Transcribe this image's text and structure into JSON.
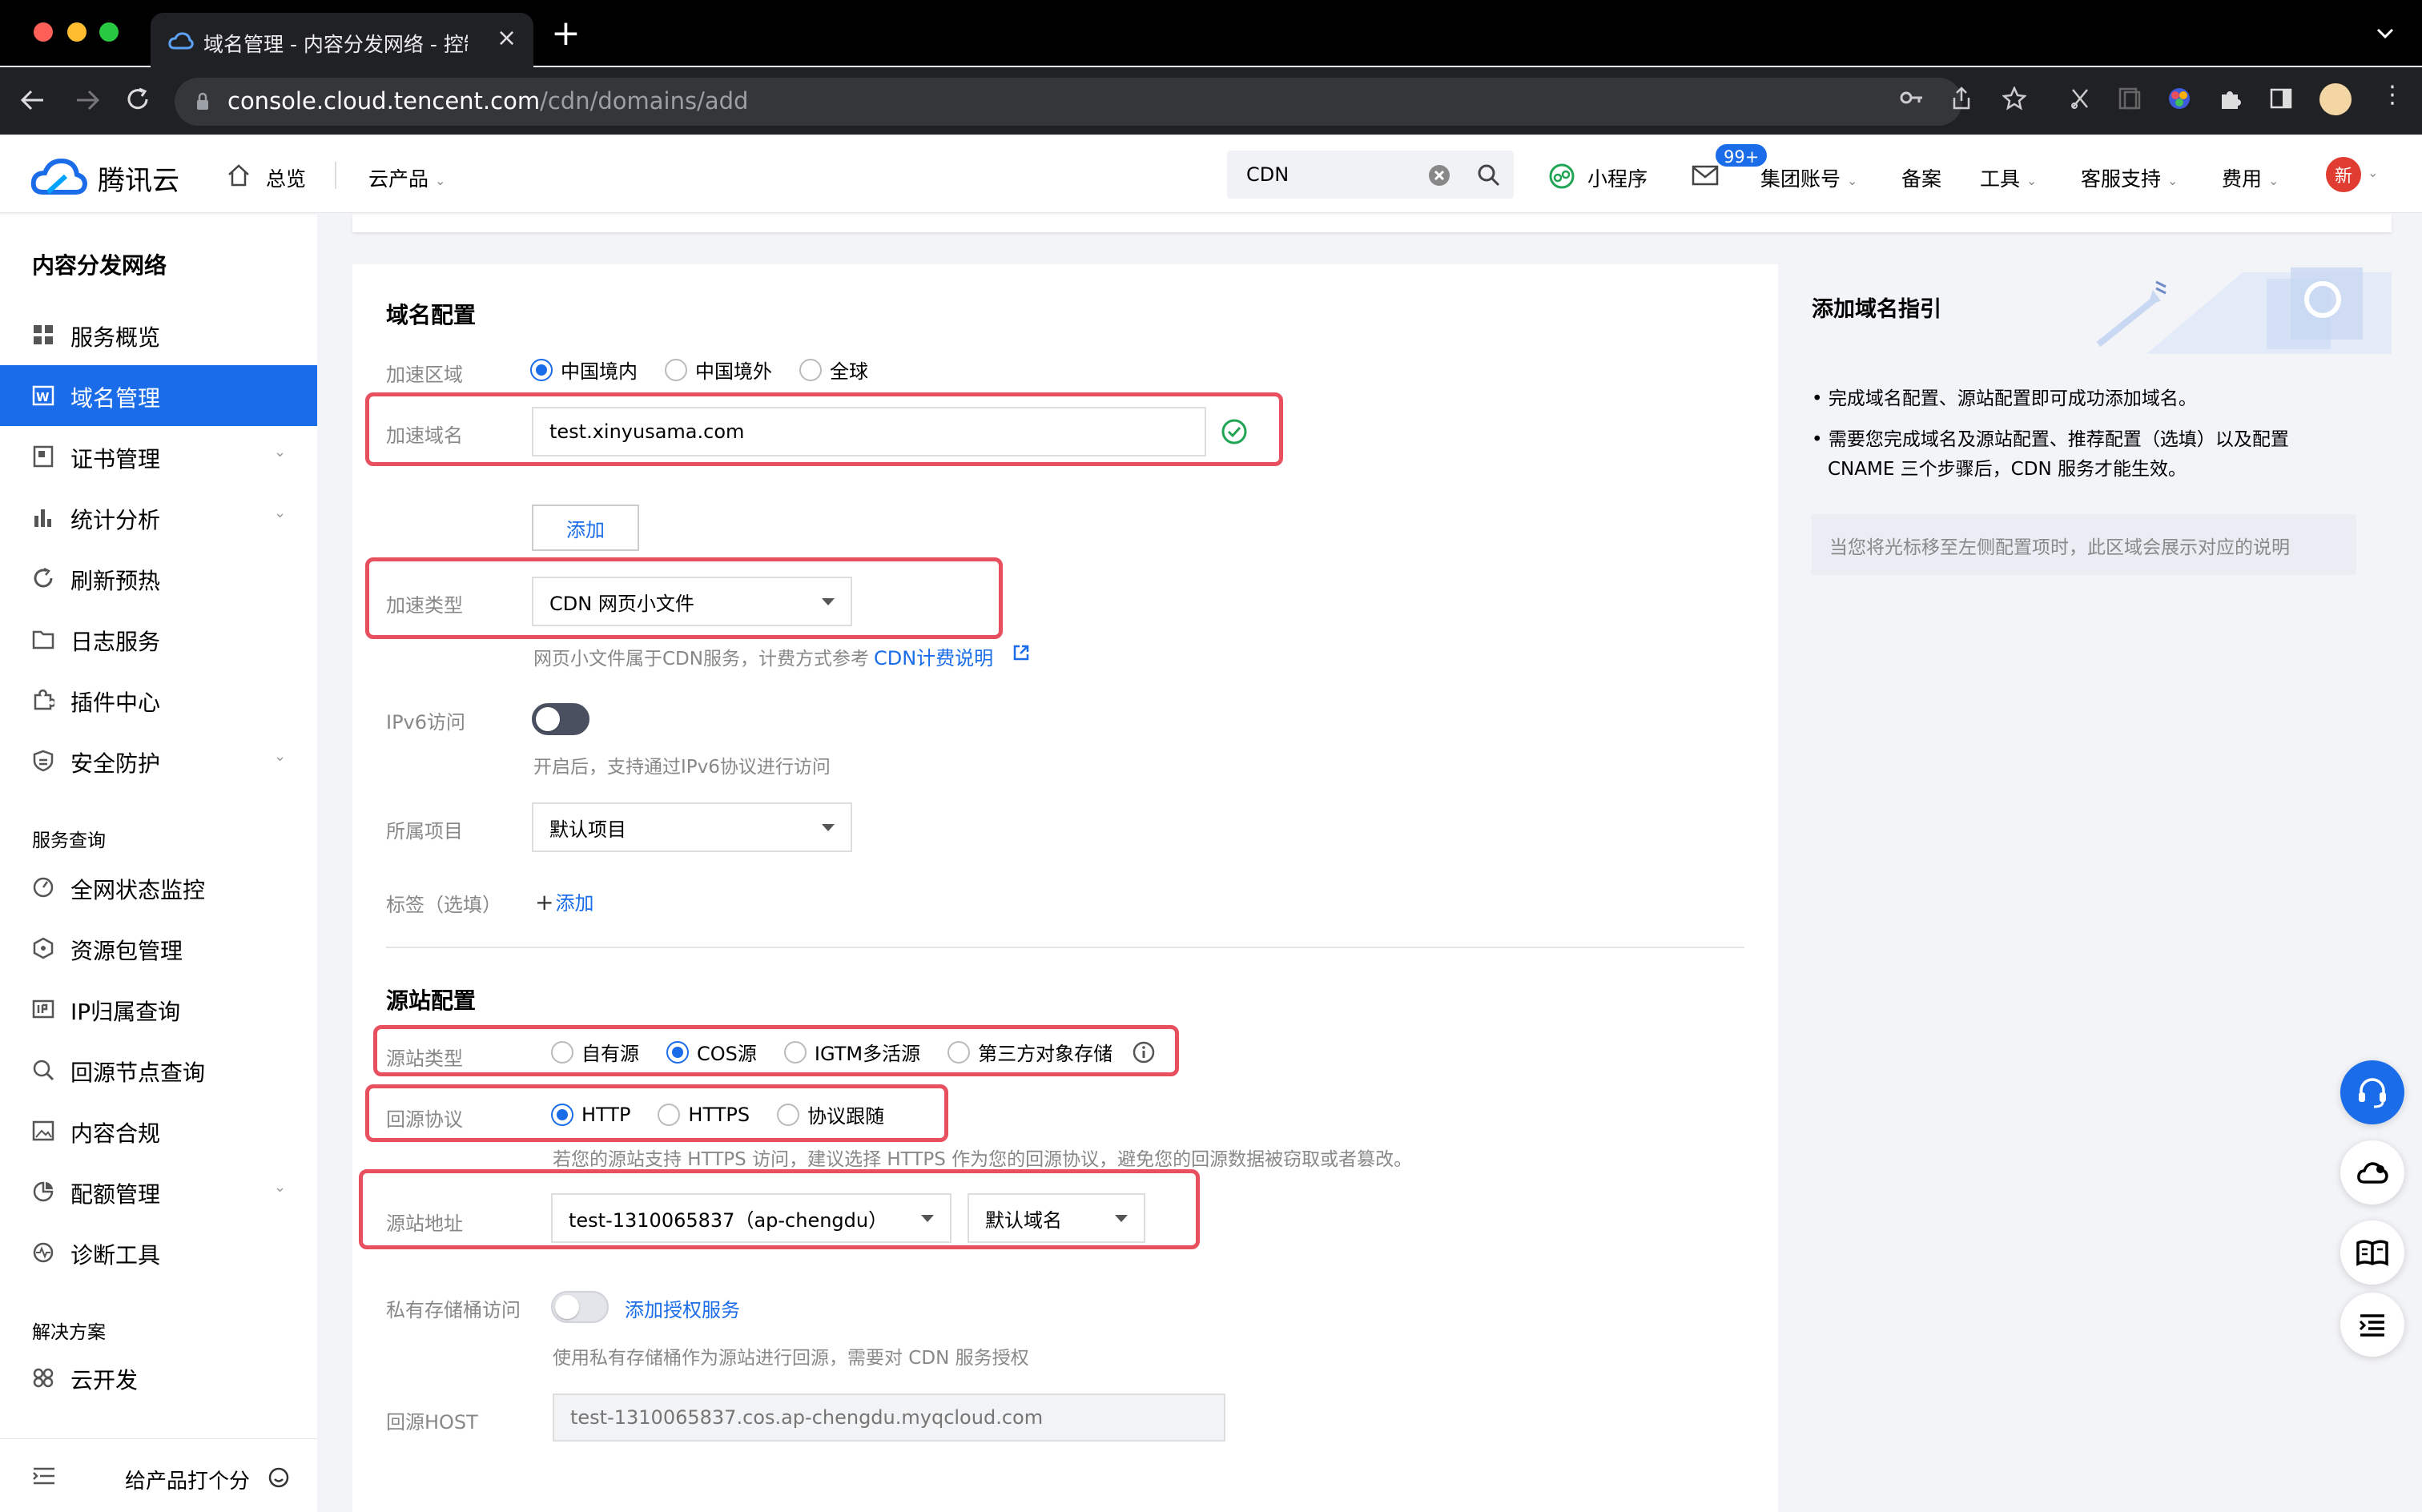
{
  "browser": {
    "tab_title": "域名管理 - 内容分发网络 - 控制",
    "url_host": "console.cloud.tencent.com",
    "url_path": "/cdn/domains/add"
  },
  "header": {
    "logo_text": "腾讯云",
    "overview": "总览",
    "products": "云产品",
    "search_value": "CDN",
    "mini_program": "小程序",
    "mail_badge": "99+",
    "group_account": "集团账号",
    "beian": "备案",
    "tools": "工具",
    "support": "客服支持",
    "fees": "费用",
    "avatar_text": "新"
  },
  "sidebar": {
    "title": "内容分发网络",
    "items": [
      {
        "label": "服务概览"
      },
      {
        "label": "域名管理"
      },
      {
        "label": "证书管理"
      },
      {
        "label": "统计分析"
      },
      {
        "label": "刷新预热"
      },
      {
        "label": "日志服务"
      },
      {
        "label": "插件中心"
      },
      {
        "label": "安全防护"
      }
    ],
    "group2_title": "服务查询",
    "group2": [
      {
        "label": "全网状态监控"
      },
      {
        "label": "资源包管理"
      },
      {
        "label": "IP归属查询"
      },
      {
        "label": "回源节点查询"
      },
      {
        "label": "内容合规"
      },
      {
        "label": "配额管理"
      },
      {
        "label": "诊断工具"
      }
    ],
    "group3_title": "解决方案",
    "group3": [
      {
        "label": "云开发"
      }
    ],
    "feedback": "给产品打个分"
  },
  "domain_config": {
    "title": "域名配置",
    "region_label": "加速区域",
    "region_options": [
      "中国境内",
      "中国境外",
      "全球"
    ],
    "domain_label": "加速域名",
    "domain_value": "test.xinyusama.com",
    "add_button": "添加",
    "type_label": "加速类型",
    "type_value": "CDN 网页小文件",
    "type_hint": "网页小文件属于CDN服务，计费方式参考",
    "type_hint_link": "CDN计费说明",
    "ipv6_label": "IPv6访问",
    "ipv6_hint": "开启后，支持通过IPv6协议进行访问",
    "project_label": "所属项目",
    "project_value": "默认项目",
    "tag_label": "标签（选填）",
    "tag_add": "添加"
  },
  "origin_config": {
    "title": "源站配置",
    "type_label": "源站类型",
    "type_options": [
      "自有源",
      "COS源",
      "IGTM多活源",
      "第三方对象存储"
    ],
    "protocol_label": "回源协议",
    "protocol_options": [
      "HTTP",
      "HTTPS",
      "协议跟随"
    ],
    "protocol_hint": "若您的源站支持 HTTPS 访问，建议选择 HTTPS 作为您的回源协议，避免您的回源数据被窃取或者篡改。",
    "address_label": "源站地址",
    "address_value": "test-1310065837（ap-chengdu）",
    "domain_type_value": "默认域名",
    "private_label": "私有存储桶访问",
    "private_link": "添加授权服务",
    "private_hint": "使用私有存储桶作为源站进行回源，需要对 CDN 服务授权",
    "host_label": "回源HOST",
    "host_placeholder": "test-1310065837.cos.ap-chengdu.myqcloud.com"
  },
  "guide": {
    "title": "添加域名指引",
    "bullet1": "完成域名配置、源站配置即可成功添加域名。",
    "bullet2_line1": "需要您完成域名及源站配置、推荐配置（选填）以及配置",
    "bullet2_line2": "CNAME 三个步骤后，CDN 服务才能生效。",
    "tip": "当您将光标移至左侧配置项时，此区域会展示对应的说明"
  },
  "colors": {
    "accent": "#1a6ce8",
    "highlight_box": "#e8505f",
    "success": "#21a453"
  }
}
